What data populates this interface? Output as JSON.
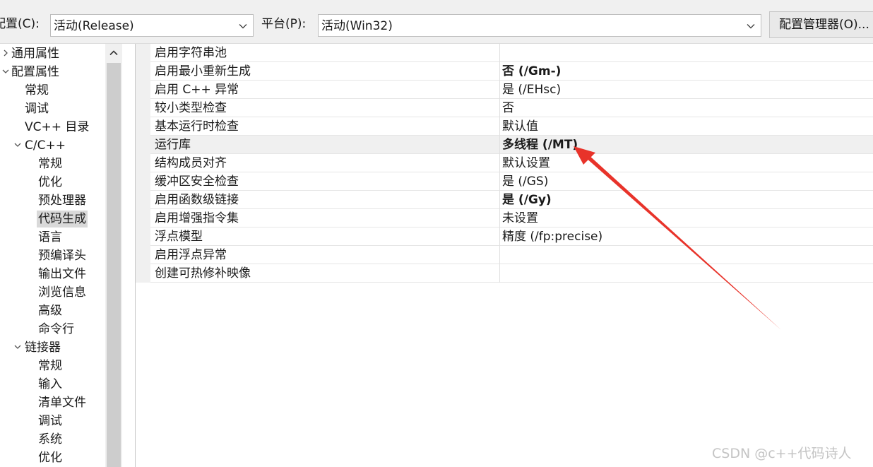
{
  "toolbar": {
    "config_label": "配置(C):",
    "config_value": "活动(Release)",
    "platform_label": "平台(P):",
    "platform_value": "活动(Win32)",
    "manager_button": "配置管理器(O)..."
  },
  "tree": {
    "items": [
      {
        "label": "通用属性",
        "level": 0,
        "arrow": "chevron-right-icon"
      },
      {
        "label": "配置属性",
        "level": 0,
        "arrow": "chevron-down-icon"
      },
      {
        "label": "常规",
        "level": 1
      },
      {
        "label": "调试",
        "level": 1
      },
      {
        "label": "VC++ 目录",
        "level": 1
      },
      {
        "label": "C/C++",
        "level": 1,
        "arrow": "chevron-down-icon"
      },
      {
        "label": "常规",
        "level": 2
      },
      {
        "label": "优化",
        "level": 2
      },
      {
        "label": "预处理器",
        "level": 2
      },
      {
        "label": "代码生成",
        "level": 2,
        "selected": true
      },
      {
        "label": "语言",
        "level": 2
      },
      {
        "label": "预编译头",
        "level": 2
      },
      {
        "label": "输出文件",
        "level": 2
      },
      {
        "label": "浏览信息",
        "level": 2
      },
      {
        "label": "高级",
        "level": 2
      },
      {
        "label": "命令行",
        "level": 2
      },
      {
        "label": "链接器",
        "level": 1,
        "arrow": "chevron-down-icon"
      },
      {
        "label": "常规",
        "level": 2
      },
      {
        "label": "输入",
        "level": 2
      },
      {
        "label": "清单文件",
        "level": 2
      },
      {
        "label": "调试",
        "level": 2
      },
      {
        "label": "系统",
        "level": 2
      },
      {
        "label": "优化",
        "level": 2
      }
    ]
  },
  "properties": {
    "rows": [
      {
        "name": "启用字符串池",
        "value": "",
        "bold": false
      },
      {
        "name": "启用最小重新生成",
        "value": "否 (/Gm-)",
        "bold": true
      },
      {
        "name": "启用 C++ 异常",
        "value": "是 (/EHsc)",
        "bold": false
      },
      {
        "name": "较小类型检查",
        "value": "否",
        "bold": false
      },
      {
        "name": "基本运行时检查",
        "value": "默认值",
        "bold": false
      },
      {
        "name": "运行库",
        "value": "多线程 (/MT)",
        "bold": true,
        "selected": true
      },
      {
        "name": "结构成员对齐",
        "value": "默认设置",
        "bold": false
      },
      {
        "name": "缓冲区安全检查",
        "value": "是 (/GS)",
        "bold": false
      },
      {
        "name": "启用函数级链接",
        "value": "是 (/Gy)",
        "bold": true
      },
      {
        "name": "启用增强指令集",
        "value": "未设置",
        "bold": false
      },
      {
        "name": "浮点模型",
        "value": "精度 (/fp:precise)",
        "bold": false
      },
      {
        "name": "启用浮点异常",
        "value": "",
        "bold": false
      },
      {
        "name": "创建可热修补映像",
        "value": "",
        "bold": false
      }
    ]
  },
  "annotation": {
    "color": "#e8332a",
    "icon": "red-arrow-icon"
  },
  "watermark": "CSDN @c++代码诗人",
  "colors": {
    "toolbar_bg": "#f0f0f0",
    "selection_bg": "#d9d9d9",
    "scroll_thumb": "#cdcdcd"
  }
}
